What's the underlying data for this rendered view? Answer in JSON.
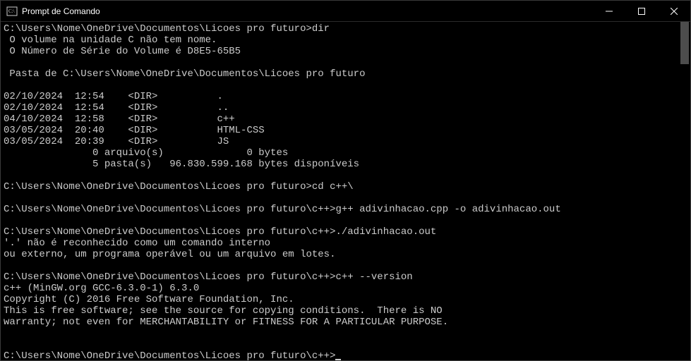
{
  "window": {
    "title": "Prompt de Comando"
  },
  "lines": [
    "C:\\Users\\Nome\\OneDrive\\Documentos\\Licoes pro futuro>dir",
    " O volume na unidade C não tem nome.",
    " O Número de Série do Volume é D8E5-65B5",
    "",
    " Pasta de C:\\Users\\Nome\\OneDrive\\Documentos\\Licoes pro futuro",
    "",
    "02/10/2024  12:54    <DIR>          .",
    "02/10/2024  12:54    <DIR>          ..",
    "04/10/2024  12:58    <DIR>          c++",
    "03/05/2024  20:40    <DIR>          HTML-CSS",
    "03/05/2024  20:39    <DIR>          JS",
    "               0 arquivo(s)              0 bytes",
    "               5 pasta(s)   96.830.599.168 bytes disponíveis",
    "",
    "C:\\Users\\Nome\\OneDrive\\Documentos\\Licoes pro futuro>cd c++\\",
    "",
    "C:\\Users\\Nome\\OneDrive\\Documentos\\Licoes pro futuro\\c++>g++ adivinhacao.cpp -o adivinhacao.out",
    "",
    "C:\\Users\\Nome\\OneDrive\\Documentos\\Licoes pro futuro\\c++>./adivinhacao.out",
    "'.' não é reconhecido como um comando interno",
    "ou externo, um programa operável ou um arquivo em lotes.",
    "",
    "C:\\Users\\Nome\\OneDrive\\Documentos\\Licoes pro futuro\\c++>c++ --version",
    "c++ (MinGW.org GCC-6.3.0-1) 6.3.0",
    "Copyright (C) 2016 Free Software Foundation, Inc.",
    "This is free software; see the source for copying conditions.  There is NO",
    "warranty; not even for MERCHANTABILITY or FITNESS FOR A PARTICULAR PURPOSE.",
    "",
    "",
    "C:\\Users\\Nome\\OneDrive\\Documentos\\Licoes pro futuro\\c++>"
  ]
}
